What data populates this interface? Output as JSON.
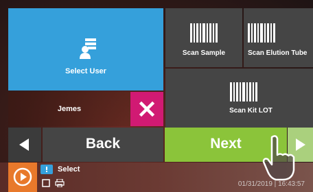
{
  "tiles": {
    "select_user": "Select User",
    "scan_sample": "Scan Sample",
    "scan_elution": "Scan Elution Tube",
    "scan_kit_lot": "Scan Kit LOT",
    "user_name": "Jemes"
  },
  "nav": {
    "back": "Back",
    "next": "Next"
  },
  "statusbar": {
    "message": "Select",
    "date": "01/31/2019 | 16:43:57"
  },
  "colors": {
    "select_user_tile": "#35a0db",
    "dark_tile": "#454545",
    "remove_button": "#d11a73",
    "next_button": "#8bc43a",
    "play_button": "#e8792b"
  },
  "icons": [
    "user-list-icon",
    "barcode-icon",
    "close-icon",
    "arrow-left-icon",
    "arrow-right-icon",
    "play-icon",
    "message-icon",
    "printer-icon",
    "hand-pointer-icon"
  ]
}
